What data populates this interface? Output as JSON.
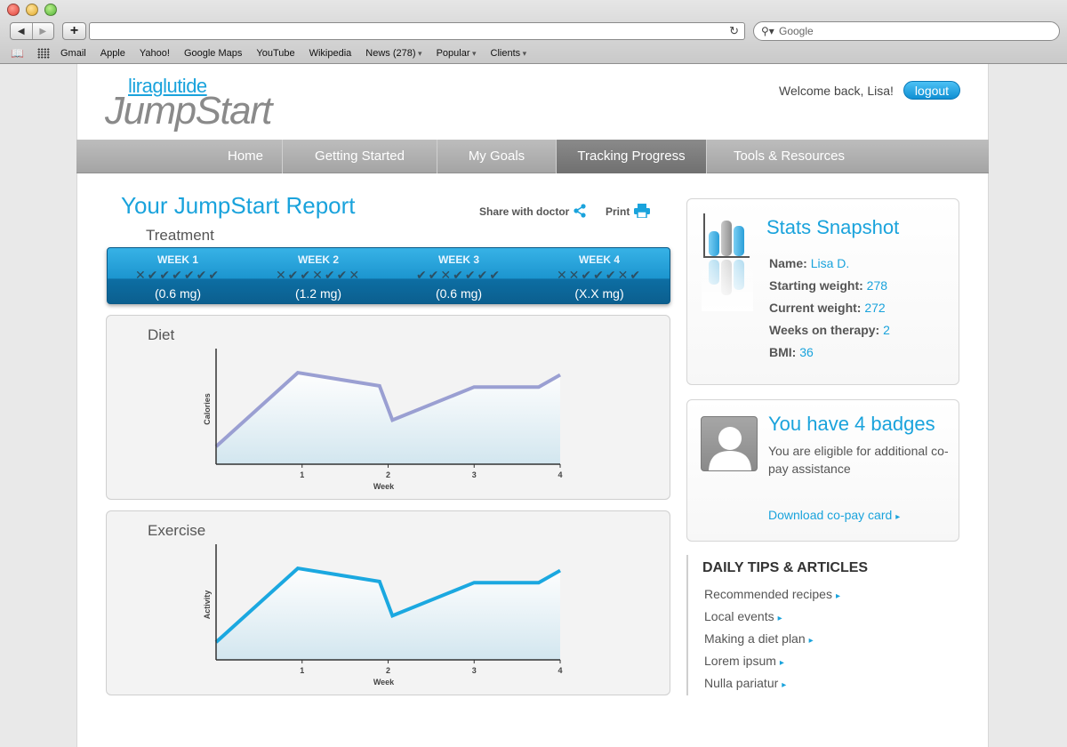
{
  "browser": {
    "search_placeholder": "Google",
    "bookmarks": [
      "Gmail",
      "Apple",
      "Yahoo!",
      "Google Maps",
      "YouTube",
      "Wikipedia",
      "News (278)",
      "Popular",
      "Clients"
    ]
  },
  "header": {
    "logo_small": "liraglutide",
    "logo_big": "JumpStart",
    "welcome": "Welcome back, Lisa!",
    "logout": "logout"
  },
  "nav": [
    "Home",
    "Getting Started",
    "My Goals",
    "Tracking Progress",
    "Tools & Resources"
  ],
  "nav_active": "Tracking Progress",
  "report": {
    "title": "Your JumpStart Report",
    "share": "Share with doctor",
    "print": "Print",
    "treatment_label": "Treatment",
    "weeks": [
      {
        "label": "WEEK 1",
        "marks": "✕✔✔✔✔✔✔",
        "dose": "(0.6 mg)"
      },
      {
        "label": "WEEK 2",
        "marks": "✕✔✔✕✔✔✕",
        "dose": "(1.2 mg)"
      },
      {
        "label": "WEEK 3",
        "marks": "✔✔✕✔✔✔✔",
        "dose": "(0.6 mg)"
      },
      {
        "label": "WEEK 4",
        "marks": "✕✕✔✔✔✕✔",
        "dose": "(X.X mg)"
      }
    ]
  },
  "chart_data": [
    {
      "type": "area",
      "title": "Diet",
      "xlabel": "Week",
      "ylabel": "Calories",
      "x_ticks": [
        "1",
        "2",
        "3",
        "4"
      ],
      "x": [
        0,
        0.95,
        1.9,
        2.05,
        3.0,
        3.75,
        4.0
      ],
      "y": [
        0.16,
        0.83,
        0.71,
        0.4,
        0.7,
        0.7,
        0.81
      ],
      "color": "#9a9fd2",
      "xlim": [
        0,
        4
      ],
      "ylim": [
        0,
        1
      ]
    },
    {
      "type": "area",
      "title": "Exercise",
      "xlabel": "Week",
      "ylabel": "Activity",
      "x_ticks": [
        "1",
        "2",
        "3",
        "4"
      ],
      "x": [
        0,
        0.95,
        1.9,
        2.05,
        3.0,
        3.75,
        4.0
      ],
      "y": [
        0.16,
        0.83,
        0.71,
        0.4,
        0.7,
        0.7,
        0.81
      ],
      "color": "#1ba8e0",
      "xlim": [
        0,
        4
      ],
      "ylim": [
        0,
        1
      ]
    }
  ],
  "stats": {
    "title": "Stats Snapshot",
    "rows": [
      {
        "label": "Name:",
        "value": "Lisa D."
      },
      {
        "label": "Starting weight:",
        "value": "278"
      },
      {
        "label": "Current weight:",
        "value": "272"
      },
      {
        "label": "Weeks on therapy:",
        "value": "2"
      },
      {
        "label": "BMI:",
        "value": "36"
      }
    ]
  },
  "badges": {
    "title": "You have 4 badges",
    "text": "You are eligible for additional co-pay assistance",
    "link": "Download co-pay card"
  },
  "tips": {
    "title": "DAILY TIPS & ARTICLES",
    "items": [
      "Recommended recipes",
      "Local events",
      "Making a diet plan",
      "Lorem ipsum",
      "Nulla pariatur"
    ]
  }
}
